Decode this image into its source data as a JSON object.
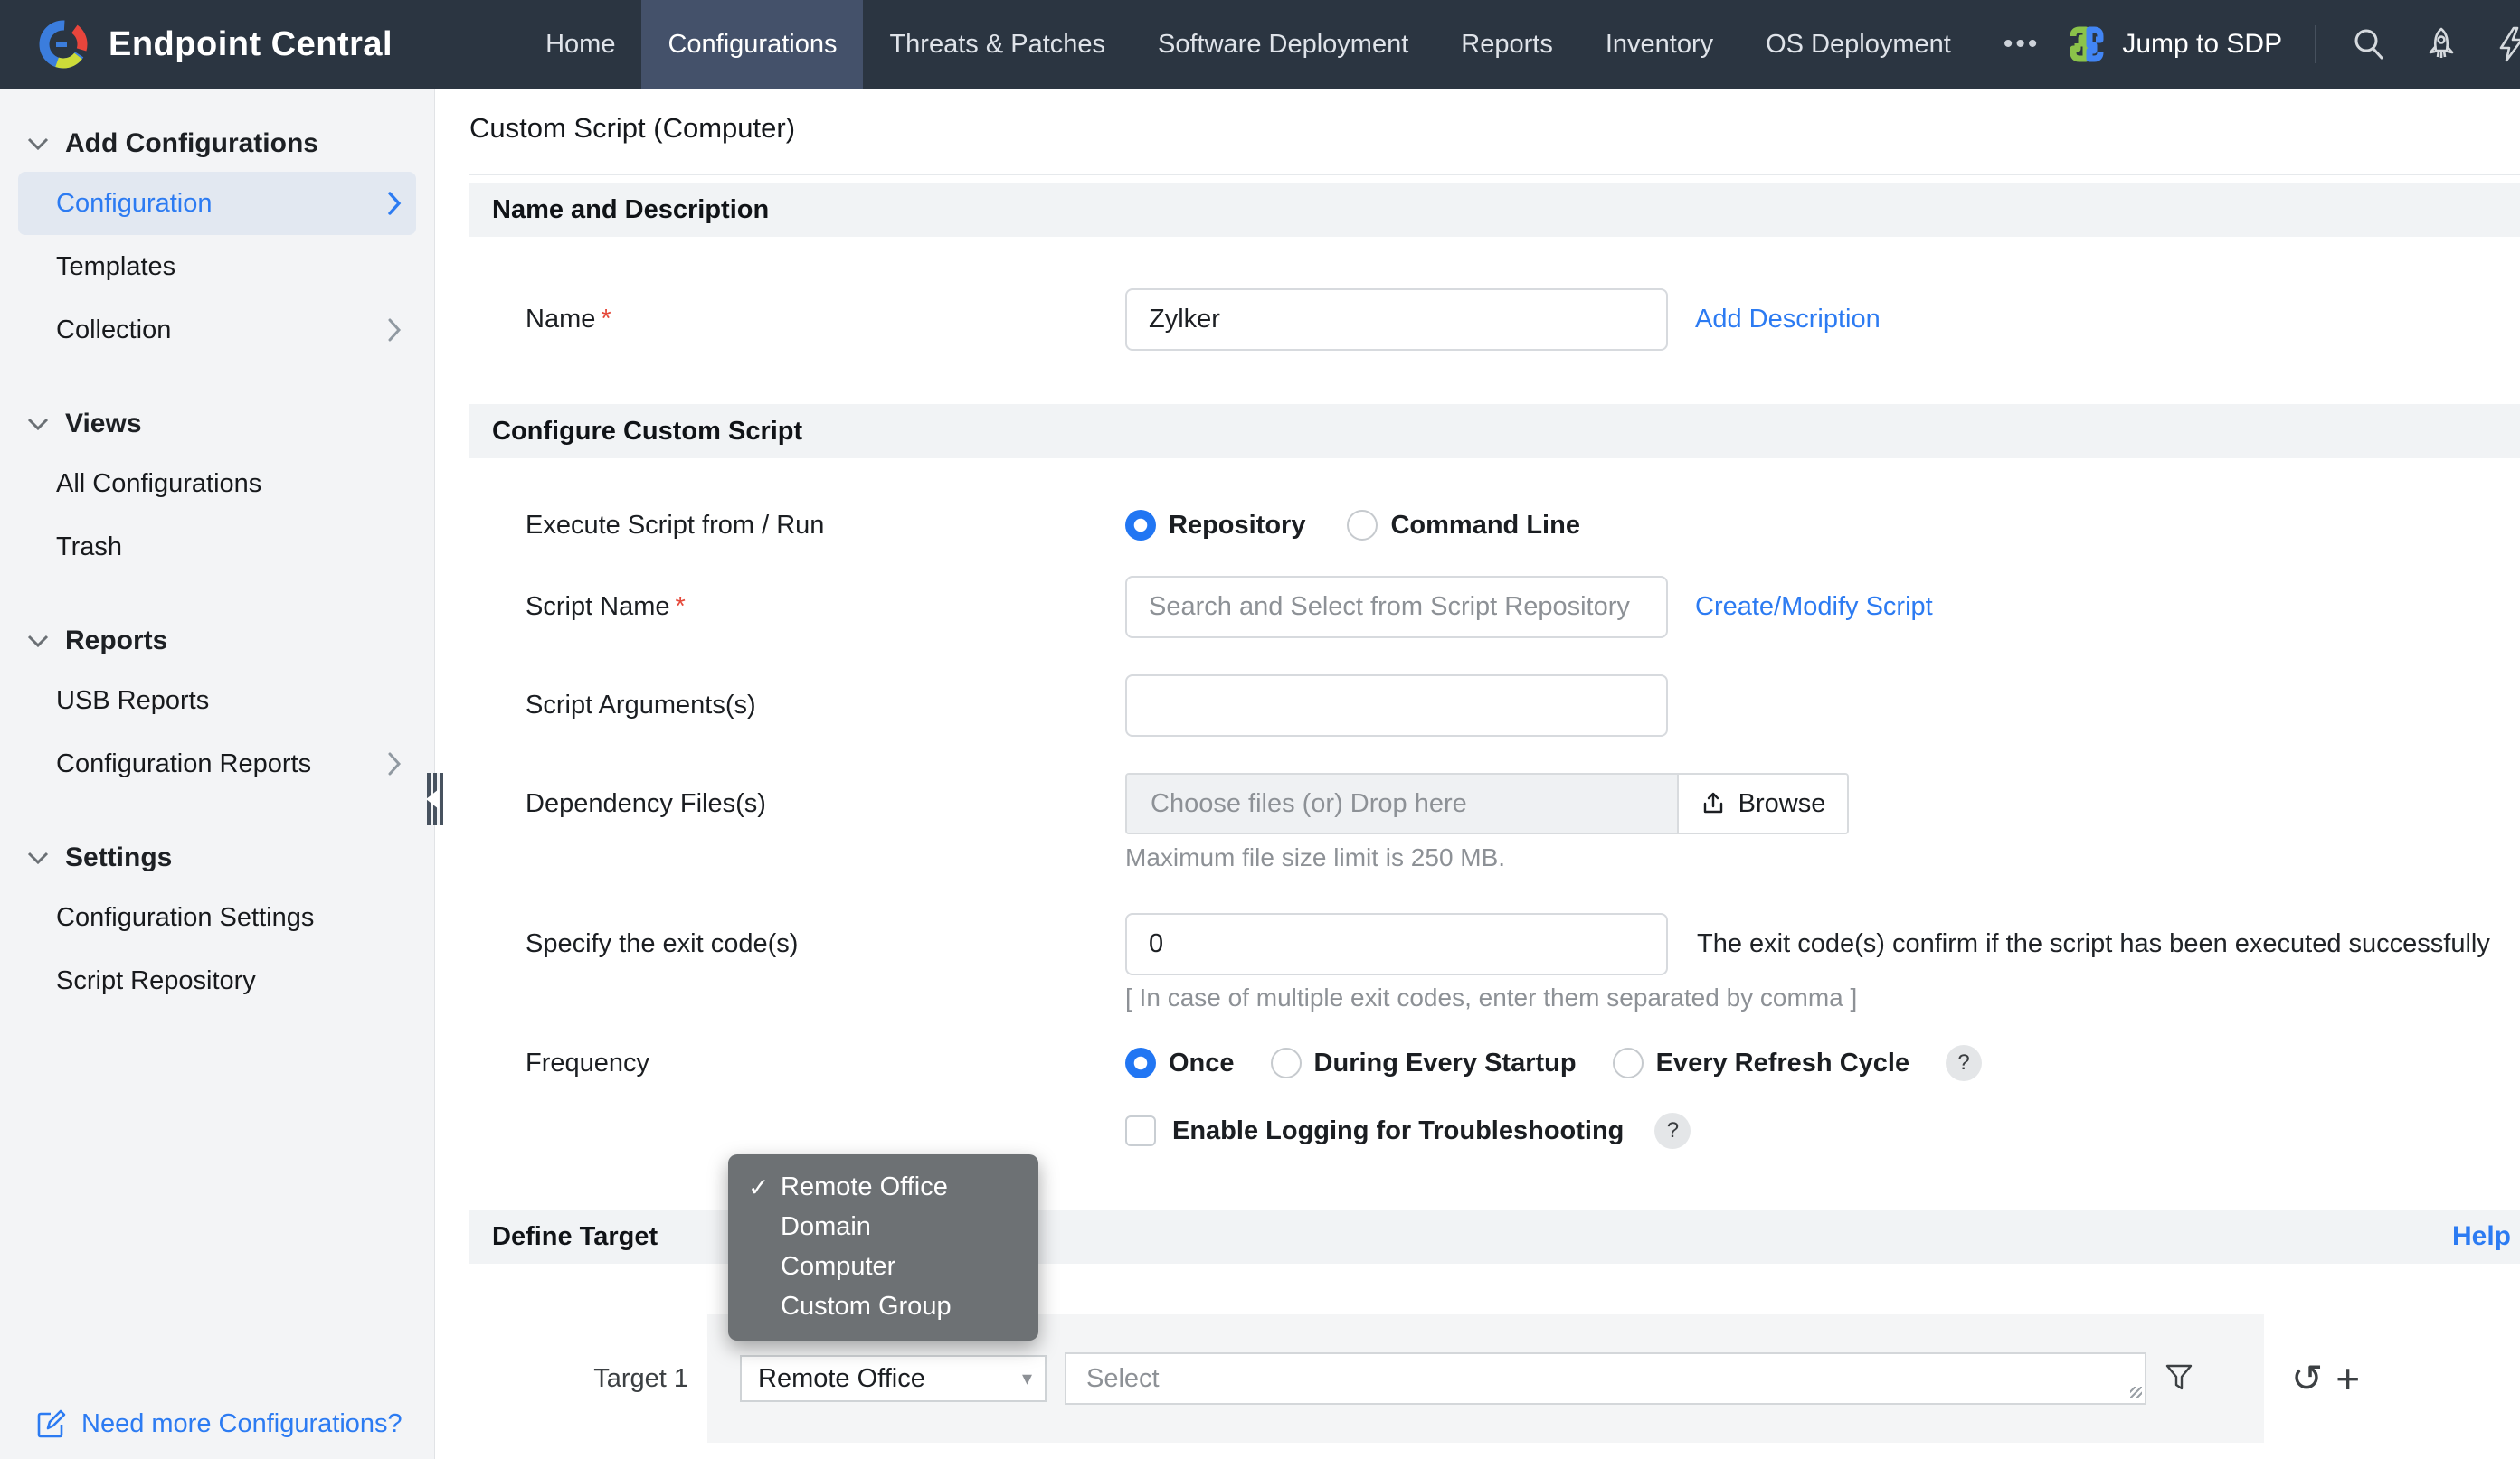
{
  "colors": {
    "accent_blue": "#2c7bf2",
    "navbar_bg": "#2b3541",
    "navbar_active_bg": "#44516a",
    "sidebar_bg": "#f3f4f6",
    "sidebar_active_bg": "#e2e8f1",
    "section_bar_bg": "#f1f3f5",
    "dropdown_bg": "#6d7174",
    "required_red": "#e5493a"
  },
  "glyphs": {
    "check": "✓",
    "ellipsis": "•••",
    "reset": "↺",
    "add": "+",
    "question": "?",
    "caret_down": "▾"
  },
  "navbar": {
    "brand": "Endpoint Central",
    "items": [
      {
        "label": "Home"
      },
      {
        "label": "Configurations"
      },
      {
        "label": "Threats & Patches"
      },
      {
        "label": "Software Deployment"
      },
      {
        "label": "Reports"
      },
      {
        "label": "Inventory"
      },
      {
        "label": "OS Deployment"
      }
    ],
    "jump_to_sdp": "Jump to SDP"
  },
  "sidebar": {
    "sections": [
      {
        "title": "Add Configurations",
        "items": [
          {
            "label": "Configuration"
          },
          {
            "label": "Templates"
          },
          {
            "label": "Collection"
          }
        ]
      },
      {
        "title": "Views",
        "items": [
          {
            "label": "All Configurations"
          },
          {
            "label": "Trash"
          }
        ]
      },
      {
        "title": "Reports",
        "items": [
          {
            "label": "USB Reports"
          },
          {
            "label": "Configuration Reports"
          }
        ]
      },
      {
        "title": "Settings",
        "items": [
          {
            "label": "Configuration Settings"
          },
          {
            "label": "Script Repository"
          }
        ]
      }
    ],
    "footer_link": "Need more Configurations?"
  },
  "page": {
    "title": "Custom Script (Computer)",
    "name_section": {
      "title": "Name and Description",
      "name_label": "Name",
      "name_value": "Zylker",
      "add_description": "Add Description"
    },
    "configure_section": {
      "title": "Configure Custom Script",
      "execute_label": "Execute Script from / Run",
      "execute_options": [
        {
          "label": "Repository"
        },
        {
          "label": "Command Line"
        }
      ],
      "script_name_label": "Script Name",
      "script_name_placeholder": "Search and Select from Script Repository",
      "create_modify_link": "Create/Modify Script",
      "script_args_label": "Script Arguments(s)",
      "dependency_label": "Dependency Files(s)",
      "dropzone_text": "Choose files (or) Drop here",
      "browse_label": "Browse",
      "max_size_note": "Maximum file size limit is 250 MB.",
      "exit_code_label": "Specify the exit code(s)",
      "exit_code_value": "0",
      "exit_code_note": "The exit code(s) confirm if the script has been executed successfully",
      "exit_code_hint": "[ In case of multiple exit codes, enter them separated by comma ]",
      "frequency_label": "Frequency",
      "frequency_options": [
        {
          "label": "Once"
        },
        {
          "label": "During Every Startup"
        },
        {
          "label": "Every Refresh Cycle"
        }
      ],
      "logging_label": "Enable Logging for Troubleshooting"
    },
    "target_section": {
      "title": "Define Target",
      "help_link": "Help",
      "dropdown_options": [
        {
          "label": "Remote Office",
          "checked": true
        },
        {
          "label": "Domain"
        },
        {
          "label": "Computer"
        },
        {
          "label": "Custom Group"
        }
      ],
      "target_label": "Target 1",
      "target_type_value": "Remote Office",
      "target_select_placeholder": "Select"
    }
  }
}
